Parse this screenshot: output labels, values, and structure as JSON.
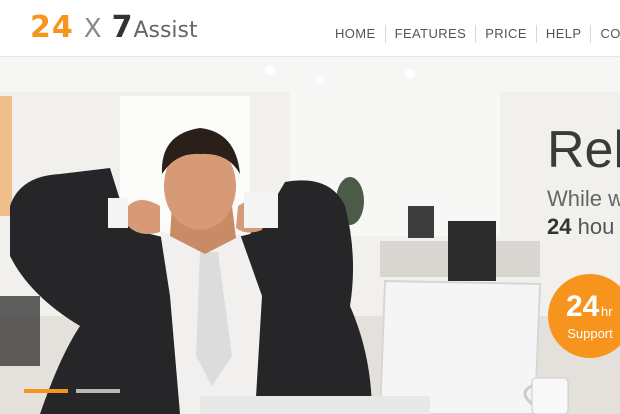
{
  "brand": {
    "part1": "24",
    "part2": "X",
    "part3": "7",
    "part4": "Assist",
    "colors": {
      "orange": "#f7941d",
      "dark": "#333333",
      "gray": "#8a8a8a"
    }
  },
  "nav": {
    "items": [
      {
        "label": "HOME"
      },
      {
        "label": "FEATURES"
      },
      {
        "label": "PRICE"
      },
      {
        "label": "HELP"
      },
      {
        "label": "CONTACT"
      }
    ]
  },
  "hero": {
    "heading": "Rel",
    "subline1": "While w",
    "subline2_bold": "24",
    "subline2_rest": " hou",
    "badge": {
      "number": "24",
      "unit": "hr",
      "label": "Support"
    },
    "slider": {
      "active_index": 0,
      "count": 2
    }
  }
}
